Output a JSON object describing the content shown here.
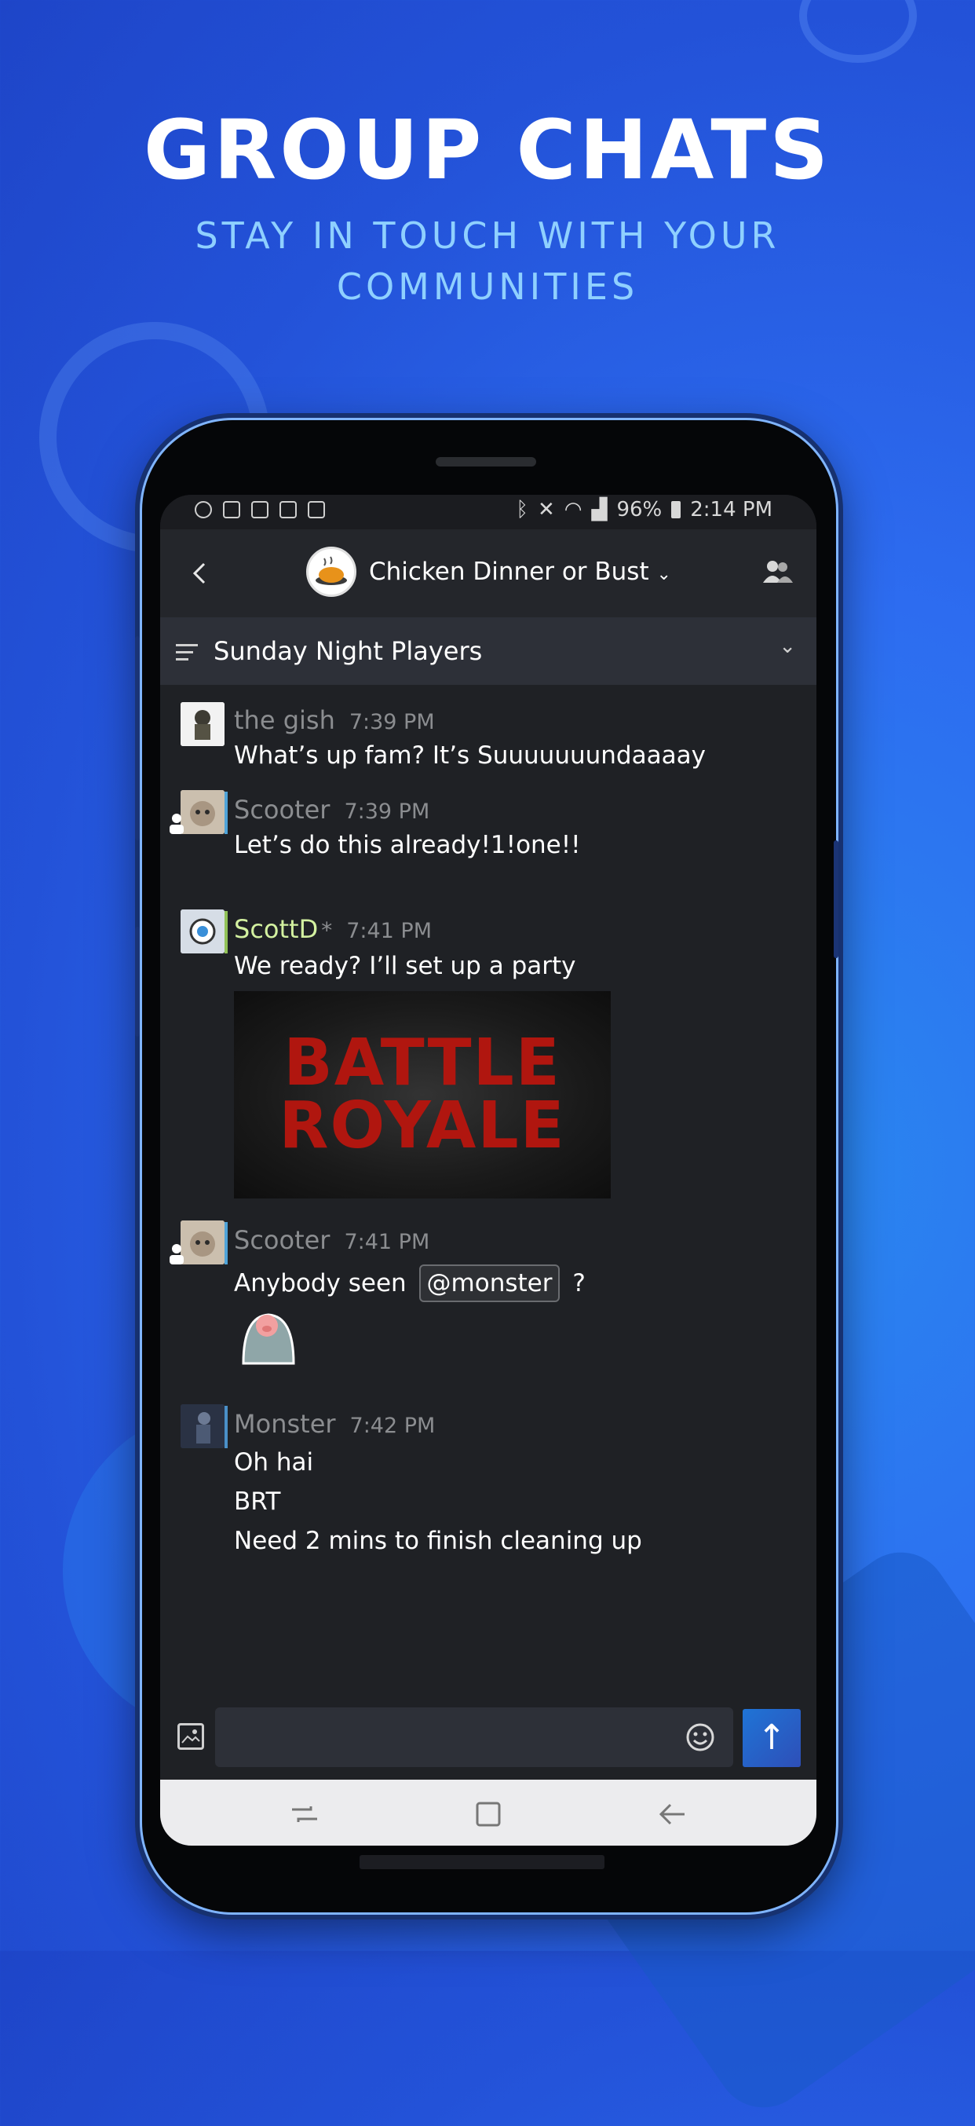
{
  "promo": {
    "title": "GROUP CHATS",
    "subtitle": "STAY IN TOUCH WITH YOUR COMMUNITIES"
  },
  "status_bar": {
    "battery": "96%",
    "time": "2:14 PM"
  },
  "header": {
    "group_name": "Chicken Dinner or Bust",
    "group_name_chevron": "⌄"
  },
  "channel": {
    "name": "Sunday Night Players"
  },
  "messages": [
    {
      "author": "the gish",
      "time": "7:39 PM",
      "lines": [
        "What’s up fam? It’s Suuuuuuundaaaay"
      ]
    },
    {
      "author": "Scooter",
      "time": "7:39 PM",
      "lines": [
        "Let’s do this already!1!one!!"
      ]
    },
    {
      "author": "ScottD",
      "author_suffix": "*",
      "time": "7:41 PM",
      "lines": [
        "We ready? I’ll set up a party"
      ],
      "image_text": [
        "BATTLE",
        "ROYALE"
      ]
    },
    {
      "author": "Scooter",
      "time": "7:41 PM",
      "text_before": "Anybody seen",
      "mention": "@monster",
      "text_after": "?"
    },
    {
      "author": "Monster",
      "time": "7:42 PM",
      "lines": [
        "Oh hai",
        "BRT",
        "Need 2 mins to finish cleaning up"
      ]
    }
  ],
  "composer": {
    "placeholder": "",
    "send_glyph": "↑"
  },
  "colors": {
    "background": "#2352d8",
    "screen": "#1f2125",
    "online_name": "#d3f1a0",
    "send_button": "#1f74d6"
  }
}
